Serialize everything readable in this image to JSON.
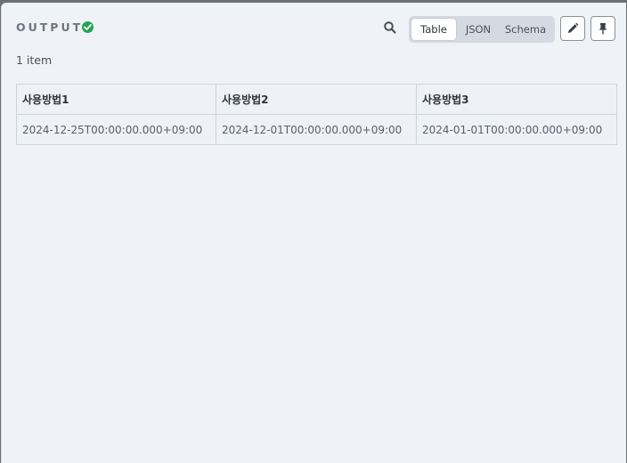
{
  "header": {
    "title": "OUTPUT",
    "status_icon": "check-circle-icon",
    "status_color": "#23a455",
    "search_icon": "search-icon",
    "view_tabs": [
      {
        "label": "Table",
        "active": true
      },
      {
        "label": "JSON",
        "active": false
      },
      {
        "label": "Schema",
        "active": false
      }
    ],
    "edit_icon": "pencil-icon",
    "pin_icon": "pin-icon"
  },
  "summary": {
    "item_count": "1 item"
  },
  "table": {
    "columns": [
      "사용방법1",
      "사용방법2",
      "사용방법3"
    ],
    "rows": [
      [
        "2024-12-25T00:00:00.000+09:00",
        "2024-12-01T00:00:00.000+09:00",
        "2024-01-01T00:00:00.000+09:00"
      ]
    ]
  }
}
